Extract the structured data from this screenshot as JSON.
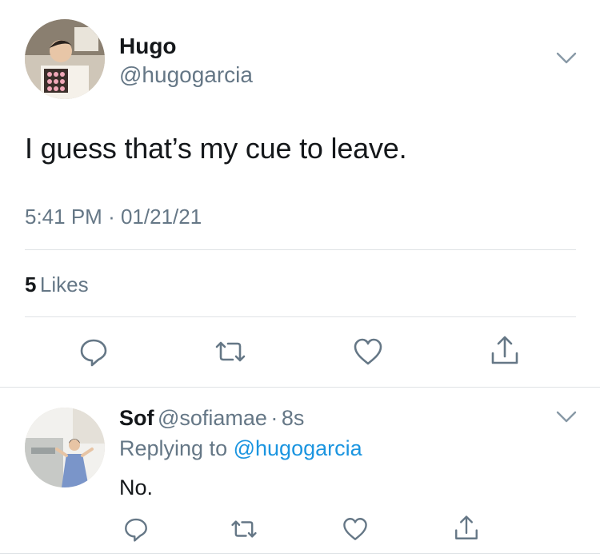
{
  "tweet": {
    "author_name": "Hugo",
    "author_handle": "@hugogarcia",
    "text": "I guess that’s my cue to leave.",
    "time": "5:41 PM",
    "separator": "·",
    "date": "01/21/21",
    "likes_count": "5",
    "likes_label": "Likes"
  },
  "reply": {
    "author_name": "Sof",
    "author_handle": "@sofiamae",
    "separator": "·",
    "age": "8s",
    "replying_prefix": "Replying to",
    "replying_mention": "@hugogarcia",
    "text": "No."
  },
  "icons": {
    "more": "chevron-down-icon",
    "reply": "reply-icon",
    "retweet": "retweet-icon",
    "like": "heart-icon",
    "share": "share-icon"
  },
  "colors": {
    "text": "#14171a",
    "secondary": "#657786",
    "link": "#1b95e0",
    "divider": "#dfe3e6"
  }
}
